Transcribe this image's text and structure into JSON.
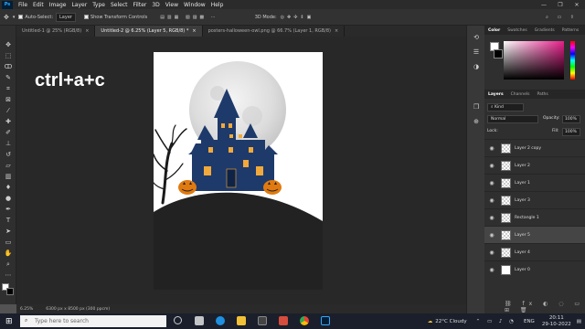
{
  "menu": [
    "File",
    "Edit",
    "Image",
    "Layer",
    "Type",
    "Select",
    "Filter",
    "3D",
    "View",
    "Window",
    "Help"
  ],
  "app_logo": "Ps",
  "options": {
    "auto_select_label": "Auto-Select:",
    "auto_select_value": "Layer",
    "show_transform_label": "Show Transform Controls",
    "mode_label": "3D Mode:"
  },
  "tabs": [
    "Untitled-1 @ 25% (RGB/8)",
    "Untitled-2 @ 6.25% (Layer 5, RGB/8) *",
    "posters-halloween-owl.png @ 66.7% (Layer 1, RGB/8)"
  ],
  "overlay_text": "ctrl+a+c",
  "status": {
    "zoom": "6.25%",
    "doc": "6300 px x 8500 px (300 ppcm)"
  },
  "color_panel": {
    "tabs": [
      "Color",
      "Swatches",
      "Gradients",
      "Patterns"
    ]
  },
  "layers_panel": {
    "tabs": [
      "Layers",
      "Channels",
      "Paths"
    ],
    "kind_label": "Kind",
    "blend_mode": "Normal",
    "opacity_label": "Opacity:",
    "opacity_value": "100%",
    "lock_label": "Lock:",
    "fill_label": "Fill:",
    "fill_value": "100%",
    "layers": [
      "Layer 2 copy",
      "Layer 2",
      "Layer 1",
      "Layer 3",
      "Rectangle 1",
      "Layer 5",
      "Layer 4",
      "Layer 0"
    ],
    "selected": "Layer 5"
  },
  "taskbar": {
    "search_placeholder": "Type here to search",
    "weather": "22°C  Cloudy",
    "lang": "ENG",
    "time": "20:11",
    "date": "29-10-2022"
  },
  "colors": {
    "accent": "#31a8ff",
    "hue_pink": "#e91e8c"
  }
}
